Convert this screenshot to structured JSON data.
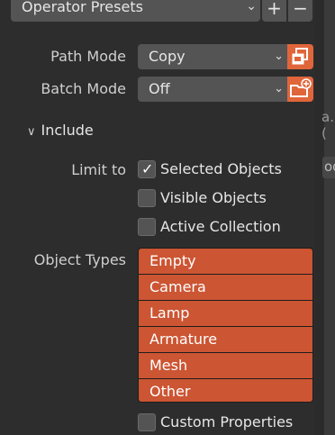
{
  "operator_presets": {
    "label": "Operator Presets",
    "add": "+",
    "remove": "−"
  },
  "path_mode": {
    "label": "Path Mode",
    "value": "Copy"
  },
  "batch_mode": {
    "label": "Batch Mode",
    "value": "Off"
  },
  "include": {
    "label": "Include"
  },
  "limit_to": {
    "label": "Limit to",
    "options": [
      {
        "label": "Selected Objects",
        "checked": true
      },
      {
        "label": "Visible Objects",
        "checked": false
      },
      {
        "label": "Active Collection",
        "checked": false
      }
    ]
  },
  "object_types": {
    "label": "Object Types",
    "items": [
      "Empty",
      "Camera",
      "Lamp",
      "Armature",
      "Mesh",
      "Other"
    ]
  },
  "custom_properties": {
    "label": "Custom Properties",
    "checked": false
  },
  "right_strip": {
    "text1": "a.(",
    "text2": "od"
  },
  "colors": {
    "accent": "#cc5533",
    "button_accent": "#e0653a",
    "panel": "#2d2d2d",
    "widget": "#545454"
  },
  "icons": {
    "path_mode_icon": "copy-files-icon",
    "batch_mode_icon": "new-folder-icon"
  }
}
